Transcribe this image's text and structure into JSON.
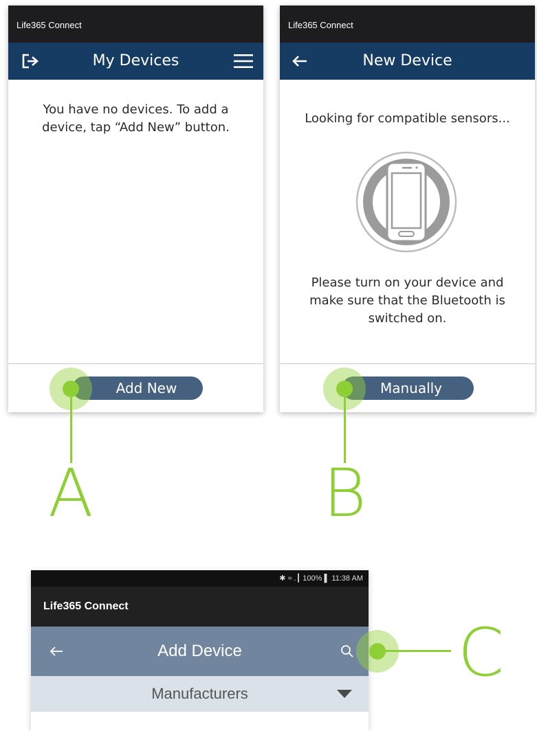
{
  "screen_a": {
    "app_title": "Life365 Connect",
    "nav_title": "My Devices",
    "empty_message": "You have no devices. To add a device, tap “Add New” button.",
    "button_label": "Add New",
    "icons": {
      "left": "logout-icon",
      "right": "hamburger-menu-icon"
    }
  },
  "screen_b": {
    "app_title": "Life365 Connect",
    "nav_title": "New Device",
    "searching_text": "Looking for compatible sensors...",
    "instruction_text": "Please turn on your device and make sure that the Bluetooth is switched on.",
    "button_label": "Manually",
    "icons": {
      "left": "back-arrow-icon",
      "illustration": "phone-scanning-icon"
    }
  },
  "screen_c": {
    "status_bar": "✱ ≈ .┃ 100% ▌ 11:38 AM",
    "app_title": "Life365 Connect",
    "nav_title": "Add Device",
    "dropdown_label": "Manufacturers",
    "icons": {
      "left": "back-arrow-icon",
      "right": "search-icon",
      "dropdown": "caret-down-icon"
    }
  },
  "callouts": {
    "a": "A",
    "b": "B",
    "c": "C"
  },
  "colors": {
    "navbar_dark": "#163c63",
    "pill": "#45617f",
    "callout_green": "#8fcf36",
    "navbar_light": "#71859e",
    "subbar": "#dbe1e9"
  }
}
